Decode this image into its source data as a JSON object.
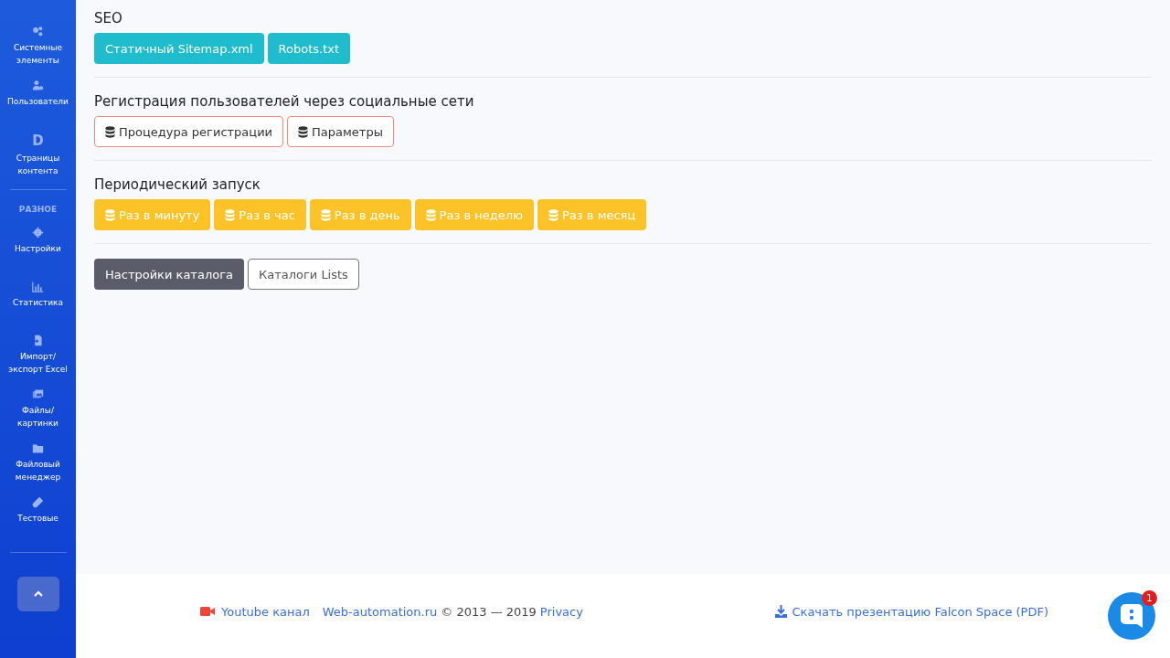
{
  "sidebar": {
    "items": [
      {
        "label": "Системные элементы"
      },
      {
        "label": "Пользователи"
      },
      {
        "glyph": "D",
        "label": "Страницы контента"
      }
    ],
    "section_heading": "РАЗНОЕ",
    "section_items": [
      {
        "label": "Настройки"
      },
      {
        "label": "Статистика"
      },
      {
        "label": "Импорт/ экспорт Excel"
      },
      {
        "label": "Файлы/ картинки"
      },
      {
        "label": "Файловый менеджер"
      },
      {
        "label": "Тестовые"
      }
    ]
  },
  "sections": [
    {
      "title": "SEO",
      "buttons": [
        {
          "kind": "info",
          "label": "Статичный Sitemap.xml"
        },
        {
          "kind": "info",
          "label": "Robots.txt"
        }
      ]
    },
    {
      "title": "Регистрация пользователей через социальные сети",
      "buttons": [
        {
          "kind": "outline-danger",
          "label": "Процедура регистрации"
        },
        {
          "kind": "outline-danger",
          "label": "Параметры"
        }
      ]
    },
    {
      "title": "Периодический запуск",
      "buttons": [
        {
          "kind": "warning",
          "label": "Раз в минуту"
        },
        {
          "kind": "warning",
          "label": "Раз в час"
        },
        {
          "kind": "warning",
          "label": "Раз в день"
        },
        {
          "kind": "warning",
          "label": "Раз в неделю"
        },
        {
          "kind": "warning",
          "label": "Раз в месяц"
        }
      ]
    },
    {
      "buttons": [
        {
          "kind": "dark",
          "label": "Настройки каталога"
        },
        {
          "kind": "outline-secondary",
          "label": "Каталоги Lists"
        }
      ]
    }
  ],
  "footer": {
    "youtube": "Youtube канал",
    "site": "Web-automation.ru",
    "copyright": "© 2013 — 2019",
    "privacy": "Privacy",
    "download": "Скачать презентацию Falcon Space (PDF)"
  },
  "chat": {
    "badge": "1"
  }
}
